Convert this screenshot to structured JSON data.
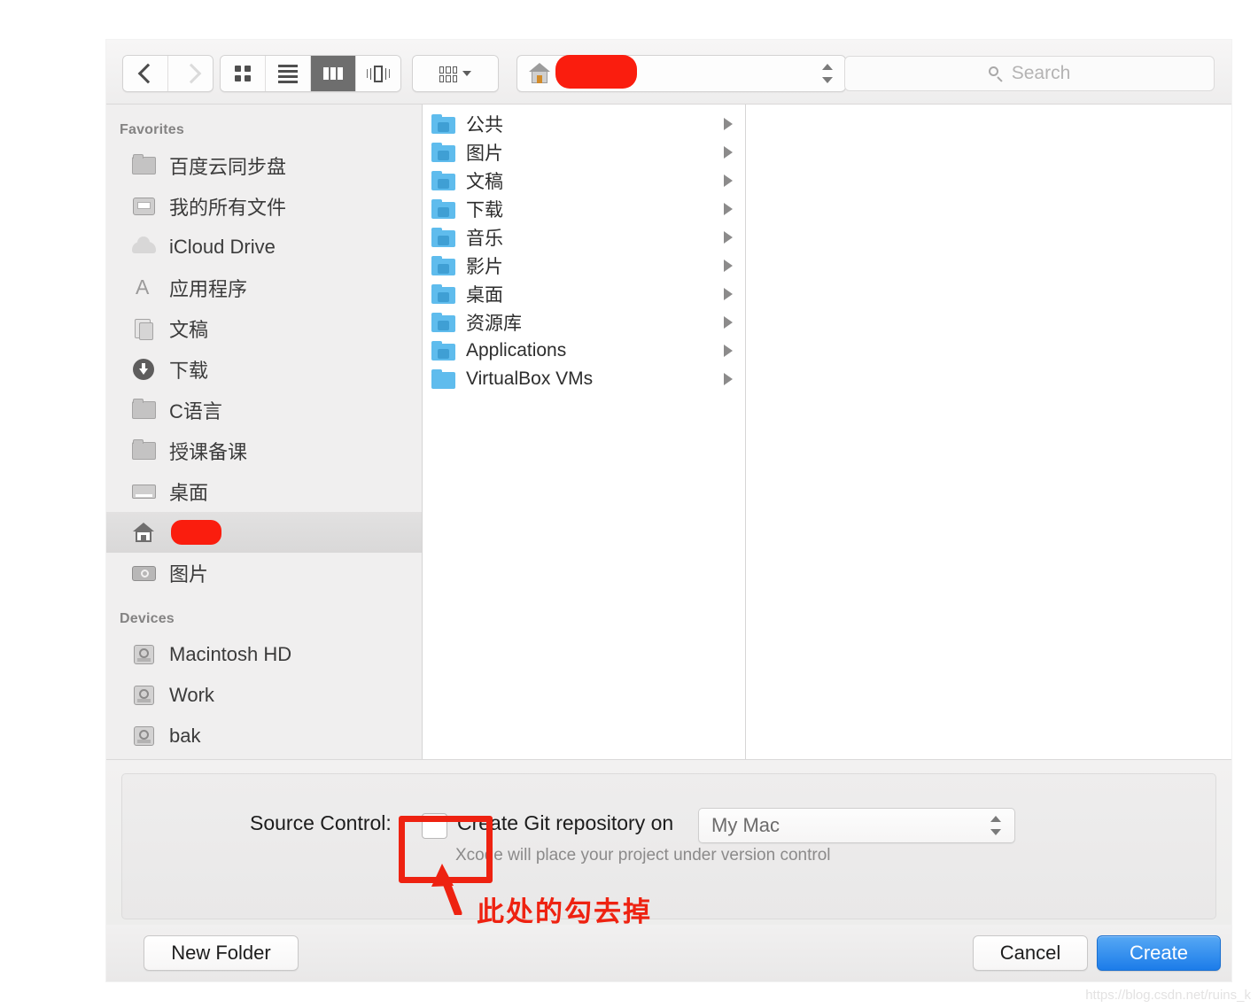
{
  "toolbar": {
    "nav": {
      "back_label": "Back",
      "forward_label": "Forward"
    },
    "view_modes": [
      {
        "id": "icon-view",
        "label": "Icon View",
        "selected": false
      },
      {
        "id": "list-view",
        "label": "List View",
        "selected": false
      },
      {
        "id": "column-view",
        "label": "Column View",
        "selected": true
      },
      {
        "id": "gallery-view",
        "label": "Gallery View",
        "selected": false
      }
    ],
    "arrange_label": "Arrange",
    "path_popup": {
      "icon": "home-icon",
      "value": "",
      "redacted": true
    },
    "search": {
      "placeholder": "Search",
      "value": "",
      "icon": "search-icon"
    }
  },
  "sidebar": {
    "sections": [
      {
        "header": "Favorites",
        "items": [
          {
            "label": "百度云同步盘",
            "icon": "folder-icon",
            "selected": false
          },
          {
            "label": "我的所有文件",
            "icon": "all-my-files-icon",
            "selected": false
          },
          {
            "label": "iCloud Drive",
            "icon": "icloud-icon",
            "selected": false
          },
          {
            "label": "应用程序",
            "icon": "applications-icon",
            "selected": false
          },
          {
            "label": "文稿",
            "icon": "documents-icon",
            "selected": false
          },
          {
            "label": "下载",
            "icon": "downloads-icon",
            "selected": false
          },
          {
            "label": "C语言",
            "icon": "folder-icon",
            "selected": false
          },
          {
            "label": "授课备课",
            "icon": "folder-icon",
            "selected": false
          },
          {
            "label": "桌面",
            "icon": "desktop-icon",
            "selected": false
          },
          {
            "label": "",
            "icon": "home-icon",
            "selected": true,
            "redacted": true
          },
          {
            "label": "图片",
            "icon": "photos-icon",
            "selected": false
          }
        ]
      },
      {
        "header": "Devices",
        "items": [
          {
            "label": "Macintosh HD",
            "icon": "disk-icon",
            "selected": false
          },
          {
            "label": "Work",
            "icon": "disk-icon",
            "selected": false
          },
          {
            "label": "bak",
            "icon": "disk-icon",
            "selected": false
          }
        ]
      }
    ]
  },
  "file_column": {
    "items": [
      {
        "label": "公共",
        "icon": "folder-public-icon",
        "has_children": true
      },
      {
        "label": "图片",
        "icon": "folder-pictures-icon",
        "has_children": true
      },
      {
        "label": "文稿",
        "icon": "folder-documents-icon",
        "has_children": true
      },
      {
        "label": "下载",
        "icon": "folder-downloads-icon",
        "has_children": true
      },
      {
        "label": "音乐",
        "icon": "folder-music-icon",
        "has_children": true
      },
      {
        "label": "影片",
        "icon": "folder-movies-icon",
        "has_children": true
      },
      {
        "label": "桌面",
        "icon": "folder-desktop-icon",
        "has_children": true
      },
      {
        "label": "资源库",
        "icon": "folder-library-icon",
        "has_children": true
      },
      {
        "label": "Applications",
        "icon": "folder-applications-icon",
        "has_children": true
      },
      {
        "label": "VirtualBox VMs",
        "icon": "folder-plain-icon",
        "has_children": true
      }
    ]
  },
  "accessory": {
    "source_control_label": "Source Control:",
    "checkbox_label": "Create Git repository on",
    "checkbox_checked": false,
    "popup_value": "My Mac",
    "hint": "Xcode will place your project under version control"
  },
  "footer": {
    "new_folder_label": "New Folder",
    "cancel_label": "Cancel",
    "create_label": "Create"
  },
  "annotation": {
    "text": "此处的勾去掉",
    "color": "#ee2211"
  },
  "watermark": "https://blog.csdn.net/ruins_k",
  "colors": {
    "accent_blue": "#1c7ce9",
    "annotation_red": "#ee2211",
    "folder_blue": "#5fbced",
    "sidebar_bg": "#f0efef"
  }
}
